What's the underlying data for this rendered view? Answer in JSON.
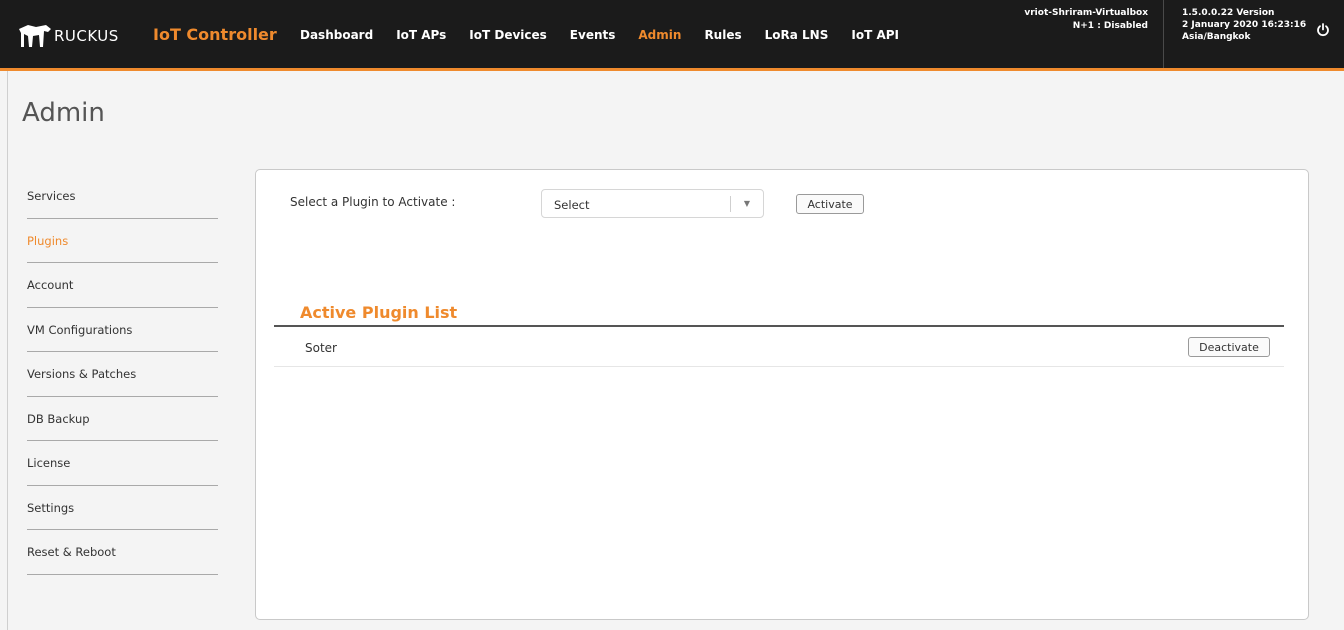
{
  "header": {
    "brand": "RUCKUS",
    "product": "IoT Controller",
    "nav": [
      {
        "label": "Dashboard",
        "active": false
      },
      {
        "label": "IoT APs",
        "active": false
      },
      {
        "label": "IoT Devices",
        "active": false
      },
      {
        "label": "Events",
        "active": false
      },
      {
        "label": "Admin",
        "active": true
      },
      {
        "label": "Rules",
        "active": false
      },
      {
        "label": "LoRa LNS",
        "active": false
      },
      {
        "label": "IoT API",
        "active": false
      }
    ],
    "hostname": "vriot-Shriram-Virtualbox",
    "ha_status": "N+1 : Disabled",
    "version": "1.5.0.0.22 Version",
    "datetime": "2 January 2020 16:23:16",
    "timezone": "Asia/Bangkok",
    "power_icon": "power-icon"
  },
  "page": {
    "title": "Admin"
  },
  "sidebar": {
    "items": [
      {
        "label": "Services",
        "active": false
      },
      {
        "label": "Plugins",
        "active": true
      },
      {
        "label": "Account",
        "active": false
      },
      {
        "label": "VM Configurations",
        "active": false
      },
      {
        "label": "Versions & Patches",
        "active": false
      },
      {
        "label": "DB Backup",
        "active": false
      },
      {
        "label": "License",
        "active": false
      },
      {
        "label": "Settings",
        "active": false
      },
      {
        "label": "Reset & Reboot",
        "active": false
      }
    ]
  },
  "plugins": {
    "select_label": "Select a Plugin to Activate :",
    "select_value": "Select",
    "activate_label": "Activate",
    "list_title": "Active Plugin List",
    "active": [
      {
        "name": "Soter",
        "action_label": "Deactivate"
      }
    ]
  },
  "colors": {
    "accent": "#ef8a2d",
    "topbar": "#1b1b1b"
  }
}
